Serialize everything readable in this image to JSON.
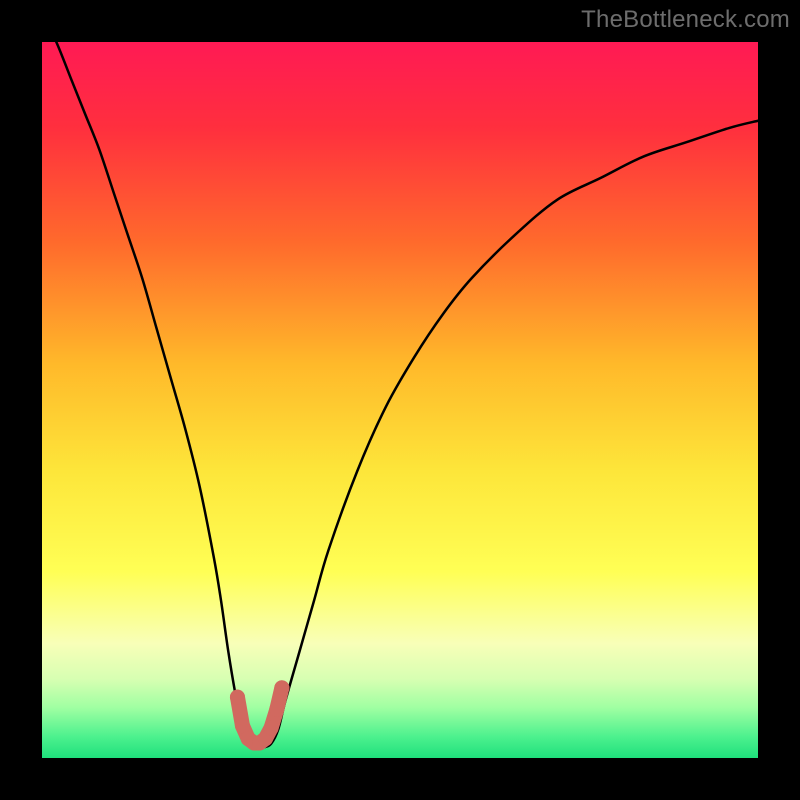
{
  "watermark": "TheBottleneck.com",
  "colors": {
    "frame": "#000000",
    "gradient_stops": [
      {
        "pct": 0,
        "color": "#ff1a54"
      },
      {
        "pct": 12,
        "color": "#ff2f3e"
      },
      {
        "pct": 28,
        "color": "#ff6a2c"
      },
      {
        "pct": 45,
        "color": "#ffb92a"
      },
      {
        "pct": 60,
        "color": "#fde63a"
      },
      {
        "pct": 74,
        "color": "#ffff55"
      },
      {
        "pct": 84,
        "color": "#f8ffb8"
      },
      {
        "pct": 89,
        "color": "#d7ffb2"
      },
      {
        "pct": 93,
        "color": "#9fffa2"
      },
      {
        "pct": 97,
        "color": "#4df18e"
      },
      {
        "pct": 100,
        "color": "#1fe07c"
      }
    ],
    "curve": "#000000",
    "marker": "#d1695f"
  },
  "chart_data": {
    "type": "line",
    "title": "",
    "xlabel": "",
    "ylabel": "",
    "xlim": [
      0,
      100
    ],
    "ylim": [
      0,
      100
    ],
    "grid": false,
    "legend": false,
    "annotations": [
      "TheBottleneck.com"
    ],
    "series": [
      {
        "name": "bottleneck-curve",
        "x": [
          0,
          2,
          4,
          6,
          8,
          10,
          12,
          14,
          16,
          18,
          20,
          22,
          24,
          25,
          26,
          27,
          28,
          29,
          30,
          31,
          32,
          33,
          34,
          36,
          38,
          40,
          44,
          48,
          52,
          56,
          60,
          66,
          72,
          78,
          84,
          90,
          96,
          100
        ],
        "y": [
          104,
          100,
          95,
          90,
          85,
          79,
          73,
          67,
          60,
          53,
          46,
          38,
          28,
          22,
          15,
          9,
          4,
          2,
          1.5,
          1.5,
          2,
          4,
          8,
          15,
          22,
          29,
          40,
          49,
          56,
          62,
          67,
          73,
          78,
          81,
          84,
          86,
          88,
          89
        ]
      }
    ],
    "optimal_marker": {
      "x": [
        27.3,
        28.0,
        28.8,
        29.6,
        30.4,
        31.2,
        32.0,
        32.8,
        33.5
      ],
      "y": [
        8.5,
        4.5,
        2.7,
        2.1,
        2.1,
        2.7,
        4.2,
        6.8,
        9.8
      ]
    }
  }
}
